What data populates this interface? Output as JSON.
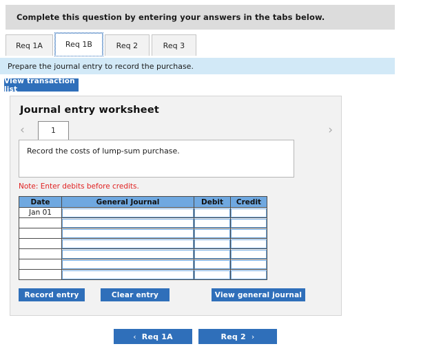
{
  "question_banner": {
    "text": "Complete this question by entering your answers in the tabs below."
  },
  "tabs": [
    {
      "label": "Req 1A",
      "active": false
    },
    {
      "label": "Req 1B",
      "active": true
    },
    {
      "label": "Req 2",
      "active": false
    },
    {
      "label": "Req 3",
      "active": false
    }
  ],
  "requirement_banner": {
    "text": "Prepare the journal entry to record the purchase."
  },
  "view_transaction_list_button": {
    "label": "View transaction list"
  },
  "worksheet": {
    "title": "Journal entry worksheet",
    "pager": {
      "prev_icon": "chevron-left-icon",
      "next_icon": "chevron-right-icon",
      "current_page": "1"
    },
    "description": "Record the costs of lump-sum purchase.",
    "note": "Note: Enter debits before credits.",
    "table": {
      "columns": [
        "Date",
        "General Journal",
        "Debit",
        "Credit"
      ],
      "rows": [
        {
          "date": "Jan 01",
          "general_journal": "",
          "debit": "",
          "credit": ""
        },
        {
          "date": "",
          "general_journal": "",
          "debit": "",
          "credit": ""
        },
        {
          "date": "",
          "general_journal": "",
          "debit": "",
          "credit": ""
        },
        {
          "date": "",
          "general_journal": "",
          "debit": "",
          "credit": ""
        },
        {
          "date": "",
          "general_journal": "",
          "debit": "",
          "credit": ""
        },
        {
          "date": "",
          "general_journal": "",
          "debit": "",
          "credit": ""
        },
        {
          "date": "",
          "general_journal": "",
          "debit": "",
          "credit": ""
        }
      ]
    },
    "buttons": {
      "record_entry": "Record entry",
      "clear_entry": "Clear entry",
      "view_general_journal": "View general journal"
    }
  },
  "bottom_nav": {
    "prev_label": "Req 1A",
    "prev_icon": "chevron-left-icon",
    "next_label": "Req 2",
    "next_icon": "chevron-right-icon"
  },
  "colors": {
    "accent_blue": "#2f6fba",
    "table_header_blue": "#6fa8e0",
    "banner_grey": "#dcdcdc",
    "banner_light_blue": "#d2e9f7",
    "note_red": "#e02020",
    "panel_grey": "#f2f2f2"
  }
}
